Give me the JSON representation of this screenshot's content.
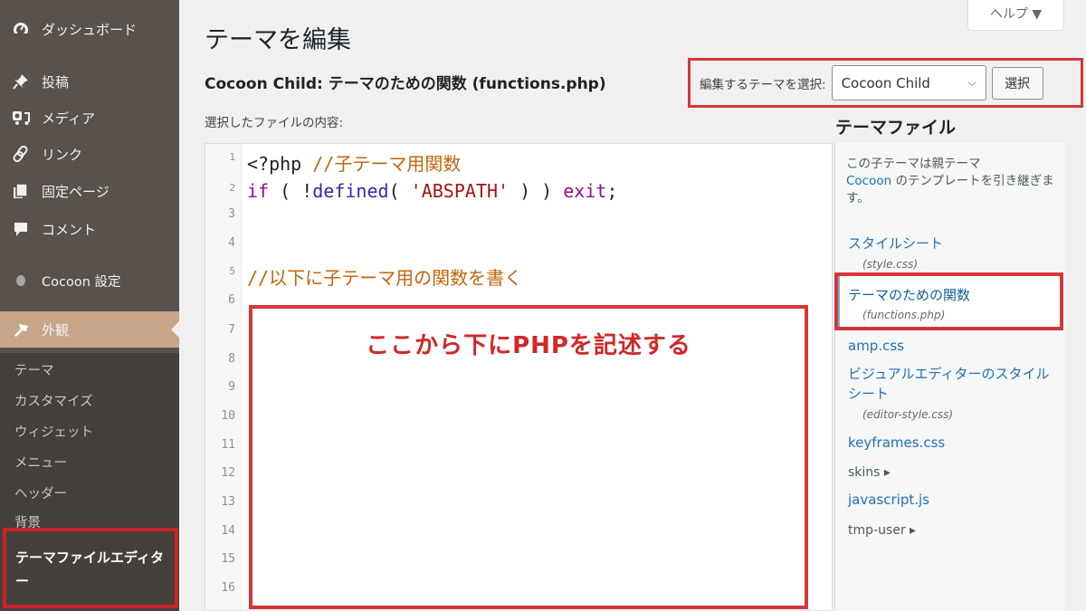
{
  "sidebar": {
    "items": [
      {
        "label": "ダッシュボード",
        "icon": "dashboard-icon"
      },
      {
        "label": "投稿",
        "icon": "pin-icon"
      },
      {
        "label": "メディア",
        "icon": "media-icon"
      },
      {
        "label": "リンク",
        "icon": "link-icon"
      },
      {
        "label": "固定ページ",
        "icon": "pages-icon"
      },
      {
        "label": "コメント",
        "icon": "comment-icon"
      },
      {
        "label": "Cocoon 設定",
        "icon": "cocoon-icon"
      },
      {
        "label": "外観",
        "icon": "appearance-icon",
        "active": true
      }
    ],
    "submenu": [
      {
        "label": "テーマ"
      },
      {
        "label": "カスタマイズ"
      },
      {
        "label": "ウィジェット"
      },
      {
        "label": "メニュー"
      },
      {
        "label": "ヘッダー"
      },
      {
        "label": "背景"
      },
      {
        "label": "テーマファイルエディター",
        "current": true
      }
    ]
  },
  "header": {
    "title": "テーマを編集",
    "help_label": "ヘルプ ▼",
    "file_heading": "Cocoon Child: テーマのための関数 (functions.php)",
    "file_content_label": "選択したファイルの内容:"
  },
  "theme_select": {
    "label": "編集するテーマを選択:",
    "selected": "Cocoon Child",
    "button": "選択"
  },
  "editor": {
    "line_numbers": [
      "1",
      "2",
      "3",
      "4",
      "5",
      "6",
      "7",
      "8",
      "9",
      "10",
      "11",
      "12",
      "13",
      "14",
      "15",
      "16"
    ],
    "lines": {
      "l1_open": "<?php ",
      "l1_comment": "//子テーマ用関数",
      "l2_if": "if",
      "l2_p1": " ( !",
      "l2_fn": "defined",
      "l2_p2": "( ",
      "l2_str": "'ABSPATH'",
      "l2_p3": " ) ) ",
      "l2_exit": "exit",
      "l2_semi": ";",
      "l5_comment": "//以下に子テーマ用の関数を書く"
    },
    "annotation": "ここから下にPHPを記述する"
  },
  "file_panel": {
    "title": "テーマファイル",
    "desc_prefix": "この子テーマは親テーマ",
    "desc_link": "Cocoon",
    "desc_suffix": " のテンプレートを引き継ぎます。",
    "files": [
      {
        "label": "スタイルシート",
        "sub": "(style.css)"
      },
      {
        "label": "テーマのための関数",
        "sub": "(functions.php)",
        "current": true
      },
      {
        "label": "amp.css"
      },
      {
        "label": "ビジュアルエディターのスタイルシート",
        "sub": "(editor-style.css)"
      },
      {
        "label": "keyframes.css"
      },
      {
        "label": "skins ▸",
        "dir": true
      },
      {
        "label": "javascript.js"
      },
      {
        "label": "tmp-user ▸",
        "dir": true
      }
    ]
  },
  "colors": {
    "sidebar_bg": "#59524c",
    "submenu_bg": "#46403c",
    "active_bg": "#c7a589",
    "annotation_red": "#d63638",
    "link_blue": "#2271b1"
  }
}
